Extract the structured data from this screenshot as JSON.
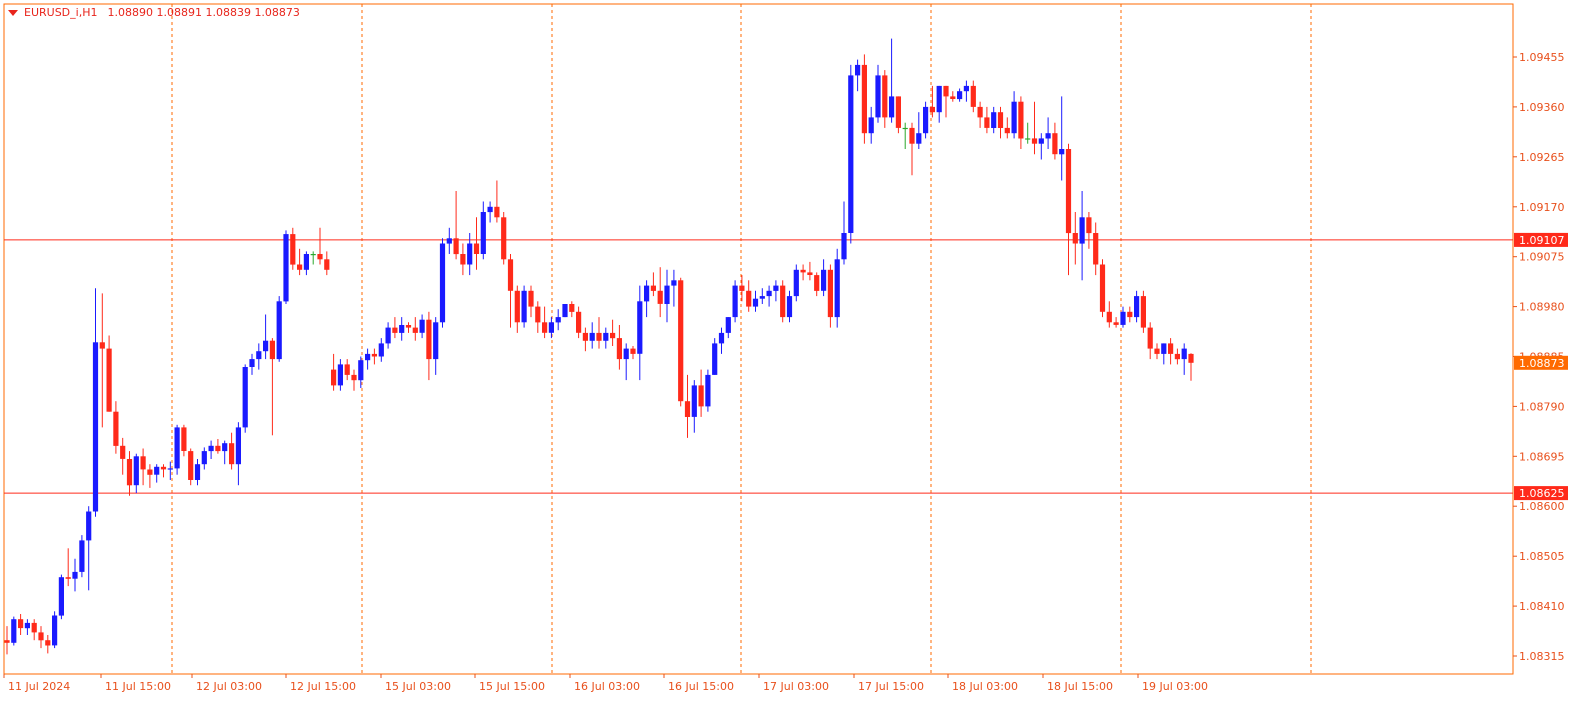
{
  "header": {
    "symbol": "EURUSD_i,H1",
    "open": "1.08890",
    "high": "1.08891",
    "low": "1.08839",
    "close": "1.08873",
    "values_text": "1.08890 1.08891 1.08839 1.08873"
  },
  "colors": {
    "up": "#1a1aff",
    "down": "#ff2a1a",
    "doji": "#2ba72b",
    "grid": "#ff6a00",
    "axis_text": "#e8501c",
    "hline": "#ff2a1a",
    "hline_label_bg": "#ff2a1a",
    "current_label_bg": "#ff6a00"
  },
  "chart_data": {
    "type": "candlestick",
    "instrument": "EURUSD_i",
    "timeframe": "H1",
    "ylim": [
      1.0827,
      1.0957
    ],
    "yticks": [
      "1.09455",
      "1.09360",
      "1.09265",
      "1.09170",
      "1.09075",
      "1.08980",
      "1.08885",
      "1.08790",
      "1.08695",
      "1.08600",
      "1.08505",
      "1.08410",
      "1.08315"
    ],
    "xticks": [
      "11 Jul 2024",
      "11 Jul 15:00",
      "12 Jul 03:00",
      "12 Jul 15:00",
      "15 Jul 03:00",
      "15 Jul 15:00",
      "16 Jul 03:00",
      "16 Jul 15:00",
      "17 Jul 03:00",
      "17 Jul 15:00",
      "18 Jul 03:00",
      "18 Jul 15:00",
      "19 Jul 03:00"
    ],
    "horizontal_lines": [
      {
        "label": "1.09107",
        "value": 1.09107
      },
      {
        "label": "1.08625",
        "value": 1.08625
      }
    ],
    "current_price": {
      "label": "1.08873",
      "value": 1.08873
    },
    "candles": [
      [
        1.08345,
        1.08372,
        1.08318,
        1.0834
      ],
      [
        1.0834,
        1.0839,
        1.08335,
        1.08385
      ],
      [
        1.08385,
        1.08395,
        1.08355,
        1.08368
      ],
      [
        1.08368,
        1.08385,
        1.08355,
        1.08378
      ],
      [
        1.08378,
        1.08385,
        1.08345,
        1.0836
      ],
      [
        1.0836,
        1.08372,
        1.0833,
        1.08345
      ],
      [
        1.08345,
        1.08355,
        1.0832,
        1.08335
      ],
      [
        1.08335,
        1.084,
        1.0833,
        1.08392
      ],
      [
        1.08392,
        1.0847,
        1.08385,
        1.08465
      ],
      [
        1.08465,
        1.0852,
        1.08448,
        1.08462
      ],
      [
        1.08462,
        1.085,
        1.08438,
        1.08475
      ],
      [
        1.08475,
        1.08545,
        1.08465,
        1.08535
      ],
      [
        1.08535,
        1.086,
        1.0844,
        1.0859
      ],
      [
        1.0859,
        1.09015,
        1.0858,
        1.08912
      ],
      [
        1.08912,
        1.09005,
        1.0875,
        1.089
      ],
      [
        1.089,
        1.08925,
        1.0878,
        1.0878
      ],
      [
        1.0878,
        1.088,
        1.087,
        1.08715
      ],
      [
        1.08715,
        1.0873,
        1.0866,
        1.0869
      ],
      [
        1.0869,
        1.08705,
        1.0862,
        1.0864
      ],
      [
        1.0864,
        1.087,
        1.08625,
        1.08695
      ],
      [
        1.08695,
        1.0871,
        1.0864,
        1.0867
      ],
      [
        1.0867,
        1.0868,
        1.08635,
        1.0866
      ],
      [
        1.0866,
        1.0868,
        1.08645,
        1.08675
      ],
      [
        1.08675,
        1.0868,
        1.08655,
        1.0867
      ],
      [
        1.0867,
        1.08685,
        1.0865,
        1.08672
      ],
      [
        1.08672,
        1.08755,
        1.0866,
        1.0875
      ],
      [
        1.0875,
        1.08755,
        1.08695,
        1.08705
      ],
      [
        1.08705,
        1.0871,
        1.0864,
        1.0865
      ],
      [
        1.0865,
        1.0869,
        1.0864,
        1.0868
      ],
      [
        1.0868,
        1.08712,
        1.0867,
        1.08705
      ],
      [
        1.08705,
        1.08725,
        1.0869,
        1.08715
      ],
      [
        1.08715,
        1.08728,
        1.087,
        1.08705
      ],
      [
        1.08705,
        1.08725,
        1.0868,
        1.0872
      ],
      [
        1.0872,
        1.0874,
        1.0867,
        1.0868
      ],
      [
        1.0868,
        1.0876,
        1.0864,
        1.0875
      ],
      [
        1.0875,
        1.0887,
        1.0874,
        1.08865
      ],
      [
        1.08865,
        1.0889,
        1.0885,
        1.0888
      ],
      [
        1.0888,
        1.0891,
        1.0886,
        1.08895
      ],
      [
        1.08895,
        1.08965,
        1.0888,
        1.08915
      ],
      [
        1.08915,
        1.0892,
        1.08735,
        1.0888
      ],
      [
        1.0888,
        1.09,
        1.08875,
        1.0899
      ],
      [
        1.0899,
        1.09125,
        1.08985,
        1.09118
      ],
      [
        1.09118,
        1.0913,
        1.0905,
        1.0906
      ],
      [
        1.0906,
        1.0909,
        1.0904,
        1.0905
      ],
      [
        1.0905,
        1.09085,
        1.0904,
        1.0908
      ],
      [
        1.0908,
        1.09085,
        1.0906,
        1.0908
      ],
      [
        1.0908,
        1.0913,
        1.0906,
        1.0907
      ],
      [
        1.0907,
        1.09085,
        1.0904,
        1.0905
      ],
      [
        1.0886,
        1.0889,
        1.0882,
        1.0883
      ],
      [
        1.0883,
        1.0888,
        1.0882,
        1.0887
      ],
      [
        1.0887,
        1.0888,
        1.0884,
        1.0885
      ],
      [
        1.0885,
        1.0886,
        1.0882,
        1.0884
      ],
      [
        1.0884,
        1.08885,
        1.08825,
        1.08878
      ],
      [
        1.08878,
        1.089,
        1.0886,
        1.0889
      ],
      [
        1.0889,
        1.089,
        1.0887,
        1.08885
      ],
      [
        1.08885,
        1.0892,
        1.08875,
        1.0891
      ],
      [
        1.0891,
        1.0895,
        1.089,
        1.0894
      ],
      [
        1.0894,
        1.0896,
        1.0892,
        1.0893
      ],
      [
        1.0893,
        1.0896,
        1.08915,
        1.08945
      ],
      [
        1.08945,
        1.0895,
        1.0893,
        1.0894
      ],
      [
        1.0894,
        1.0896,
        1.08915,
        1.0893
      ],
      [
        1.0893,
        1.08965,
        1.0892,
        1.08955
      ],
      [
        1.08955,
        1.0897,
        1.0884,
        1.0888
      ],
      [
        1.0888,
        1.0896,
        1.0885,
        1.0895
      ],
      [
        1.0895,
        1.0911,
        1.0894,
        1.091
      ],
      [
        1.091,
        1.0913,
        1.0908,
        1.0911
      ],
      [
        1.0911,
        1.092,
        1.0907,
        1.0908
      ],
      [
        1.0908,
        1.091,
        1.0904,
        1.0906
      ],
      [
        1.0906,
        1.0912,
        1.0904,
        1.091
      ],
      [
        1.091,
        1.0915,
        1.0905,
        1.0908
      ],
      [
        1.0908,
        1.0918,
        1.0907,
        1.0916
      ],
      [
        1.0916,
        1.0918,
        1.0914,
        1.0917
      ],
      [
        1.0917,
        1.0922,
        1.0914,
        1.0915
      ],
      [
        1.0915,
        1.0916,
        1.0906,
        1.0907
      ],
      [
        1.0907,
        1.0908,
        1.0894,
        1.0901
      ],
      [
        1.0901,
        1.0902,
        1.0893,
        1.0895
      ],
      [
        1.0895,
        1.0902,
        1.0894,
        1.0901
      ],
      [
        1.0901,
        1.0902,
        1.0896,
        1.0898
      ],
      [
        1.0898,
        1.0899,
        1.0893,
        1.0895
      ],
      [
        1.0895,
        1.0898,
        1.0892,
        1.0893
      ],
      [
        1.0893,
        1.0896,
        1.0892,
        1.0895
      ],
      [
        1.0895,
        1.08975,
        1.08935,
        1.0896
      ],
      [
        1.0896,
        1.08985,
        1.0896,
        1.08985
      ],
      [
        1.08985,
        1.0899,
        1.0896,
        1.0897
      ],
      [
        1.0897,
        1.0898,
        1.0892,
        1.0893
      ],
      [
        1.0893,
        1.0894,
        1.08895,
        1.08915
      ],
      [
        1.08915,
        1.0895,
        1.089,
        1.0893
      ],
      [
        1.0893,
        1.0896,
        1.089,
        1.08915
      ],
      [
        1.08915,
        1.0894,
        1.089,
        1.0893
      ],
      [
        1.0893,
        1.08955,
        1.08905,
        1.0892
      ],
      [
        1.0892,
        1.08945,
        1.0886,
        1.0888
      ],
      [
        1.0888,
        1.0891,
        1.0884,
        1.089
      ],
      [
        1.089,
        1.08905,
        1.0888,
        1.0889
      ],
      [
        1.0889,
        1.0902,
        1.0884,
        1.0899
      ],
      [
        1.0899,
        1.0903,
        1.0896,
        1.0902
      ],
      [
        1.0902,
        1.09045,
        1.09,
        1.0901
      ],
      [
        1.0901,
        1.09055,
        1.0896,
        1.08985
      ],
      [
        1.08985,
        1.0905,
        1.0895,
        1.0902
      ],
      [
        1.0902,
        1.0905,
        1.0898,
        1.0903
      ],
      [
        1.0903,
        1.09035,
        1.0879,
        1.088
      ],
      [
        1.088,
        1.0885,
        1.0873,
        1.0877
      ],
      [
        1.0877,
        1.0884,
        1.0874,
        1.0883
      ],
      [
        1.0883,
        1.0886,
        1.0877,
        1.0879
      ],
      [
        1.0879,
        1.0886,
        1.0878,
        1.0885
      ],
      [
        1.0885,
        1.0892,
        1.0885,
        1.0891
      ],
      [
        1.0891,
        1.0894,
        1.0889,
        1.0893
      ],
      [
        1.0893,
        1.0896,
        1.0892,
        1.0896
      ],
      [
        1.0896,
        1.0903,
        1.0895,
        1.0902
      ],
      [
        1.0902,
        1.0904,
        1.0899,
        1.0901
      ],
      [
        1.0901,
        1.0903,
        1.0897,
        1.0898
      ],
      [
        1.0898,
        1.0901,
        1.0897,
        1.08995
      ],
      [
        1.08995,
        1.09015,
        1.08985,
        1.09
      ],
      [
        1.09,
        1.0902,
        1.0898,
        1.0901
      ],
      [
        1.0901,
        1.0903,
        1.0899,
        1.0902
      ],
      [
        1.0902,
        1.0903,
        1.0895,
        1.0896
      ],
      [
        1.0896,
        1.0901,
        1.0895,
        1.09
      ],
      [
        1.09,
        1.0906,
        1.0899,
        1.0905
      ],
      [
        1.0905,
        1.0906,
        1.0903,
        1.09045
      ],
      [
        1.09045,
        1.09065,
        1.0903,
        1.0904
      ],
      [
        1.0904,
        1.09045,
        1.09,
        1.0901
      ],
      [
        1.0901,
        1.0907,
        1.09,
        1.0905
      ],
      [
        1.0905,
        1.0906,
        1.0894,
        1.0896
      ],
      [
        1.0896,
        1.0909,
        1.0894,
        1.0907
      ],
      [
        1.0907,
        1.0918,
        1.0906,
        1.0912
      ],
      [
        1.0912,
        1.0944,
        1.091,
        1.0942
      ],
      [
        1.0942,
        1.0945,
        1.0939,
        1.0944
      ],
      [
        1.0944,
        1.0946,
        1.0929,
        1.0931
      ],
      [
        1.0931,
        1.0936,
        1.0929,
        1.0934
      ],
      [
        1.0934,
        1.0944,
        1.0933,
        1.0942
      ],
      [
        1.0942,
        1.0943,
        1.0932,
        1.0934
      ],
      [
        1.0934,
        1.0949,
        1.0933,
        1.0938
      ],
      [
        1.0938,
        1.0938,
        1.0931,
        1.0932
      ],
      [
        1.0932,
        1.0933,
        1.0928,
        1.0932
      ],
      [
        1.0932,
        1.0933,
        1.0923,
        1.0929
      ],
      [
        1.0929,
        1.0935,
        1.0928,
        1.0931
      ],
      [
        1.0931,
        1.0937,
        1.093,
        1.0936
      ],
      [
        1.0936,
        1.094,
        1.0934,
        1.0935
      ],
      [
        1.0935,
        1.094,
        1.0933,
        1.094
      ],
      [
        1.094,
        1.094,
        1.0934,
        1.0938
      ],
      [
        1.0938,
        1.0939,
        1.0937,
        1.09375
      ],
      [
        1.09375,
        1.09395,
        1.0937,
        1.0939
      ],
      [
        1.0939,
        1.0941,
        1.0937,
        1.094
      ],
      [
        1.094,
        1.0941,
        1.0935,
        1.0936
      ],
      [
        1.0936,
        1.0937,
        1.0932,
        1.0934
      ],
      [
        1.0934,
        1.0936,
        1.0931,
        1.0932
      ],
      [
        1.0932,
        1.0936,
        1.0931,
        1.0935
      ],
      [
        1.0935,
        1.0936,
        1.093,
        1.0932
      ],
      [
        1.0932,
        1.0934,
        1.093,
        1.0931
      ],
      [
        1.0931,
        1.0939,
        1.093,
        1.0937
      ],
      [
        1.0937,
        1.0938,
        1.0928,
        1.093
      ],
      [
        1.093,
        1.0933,
        1.0929,
        1.093
      ],
      [
        1.093,
        1.0937,
        1.0927,
        1.0929
      ],
      [
        1.0929,
        1.0931,
        1.0926,
        1.093
      ],
      [
        1.093,
        1.0934,
        1.0928,
        1.0931
      ],
      [
        1.0931,
        1.0933,
        1.0926,
        1.0927
      ],
      [
        1.0927,
        1.0938,
        1.0922,
        1.0928
      ],
      [
        1.0928,
        1.0929,
        1.0904,
        1.0912
      ],
      [
        1.0912,
        1.0916,
        1.0906,
        1.091
      ],
      [
        1.091,
        1.092,
        1.0903,
        1.0915
      ],
      [
        1.0915,
        1.0916,
        1.0909,
        1.0912
      ],
      [
        1.0912,
        1.0914,
        1.0904,
        1.0906
      ],
      [
        1.0906,
        1.0907,
        1.0896,
        1.0897
      ],
      [
        1.0897,
        1.0899,
        1.0894,
        1.0895
      ],
      [
        1.0895,
        1.0896,
        1.0894,
        1.08945
      ],
      [
        1.08945,
        1.0898,
        1.0894,
        1.0897
      ],
      [
        1.0897,
        1.0898,
        1.0895,
        1.0896
      ],
      [
        1.0896,
        1.0901,
        1.0895,
        1.09
      ],
      [
        1.09,
        1.0901,
        1.0893,
        1.0894
      ],
      [
        1.0894,
        1.0895,
        1.0888,
        1.089
      ],
      [
        1.089,
        1.0891,
        1.0888,
        1.0889
      ],
      [
        1.0889,
        1.0891,
        1.0887,
        1.0891
      ],
      [
        1.0891,
        1.0892,
        1.0887,
        1.0889
      ],
      [
        1.0889,
        1.089,
        1.0887,
        1.0888
      ],
      [
        1.0888,
        1.0891,
        1.0885,
        1.089
      ],
      [
        1.0889,
        1.08891,
        1.08839,
        1.08873
      ]
    ]
  }
}
